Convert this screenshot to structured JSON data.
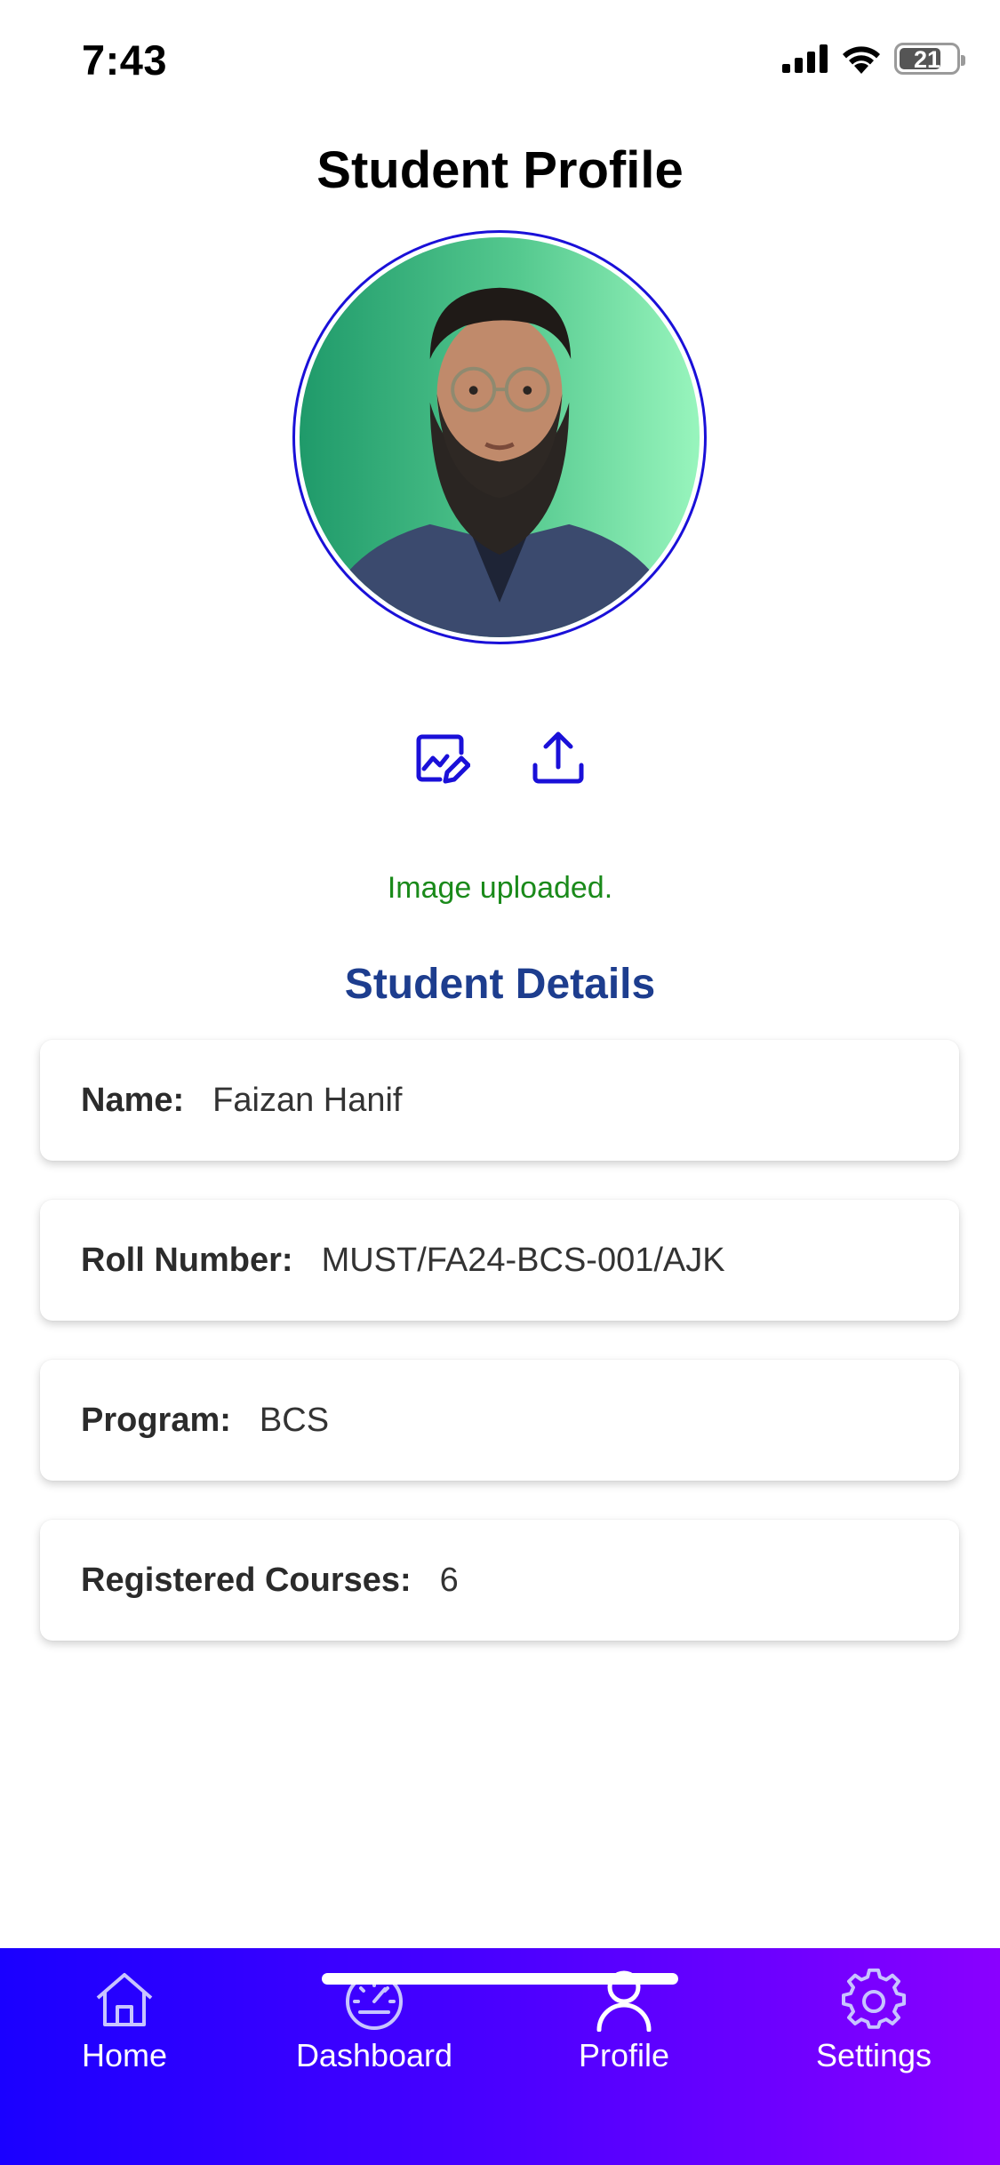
{
  "status_bar": {
    "time": "7:43",
    "battery": "21",
    "battery_level": 0.21
  },
  "page_title": "Student Profile",
  "actions": {
    "edit_icon": "image-edit-icon",
    "upload_icon": "upload-icon"
  },
  "upload_status": "Image uploaded.",
  "section_title": "Student Details",
  "details": [
    {
      "label": "Name:",
      "value": "Faizan Hanif"
    },
    {
      "label": "Roll Number:",
      "value": "MUST/FA24-BCS-001/AJK"
    },
    {
      "label": "Program:",
      "value": "BCS"
    },
    {
      "label": "Registered Courses:",
      "value": "6"
    }
  ],
  "tabs": [
    {
      "label": "Home",
      "icon": "home-icon"
    },
    {
      "label": "Dashboard",
      "icon": "speedometer-icon"
    },
    {
      "label": "Profile",
      "icon": "person-icon"
    },
    {
      "label": "Settings",
      "icon": "gear-icon"
    }
  ],
  "colors": {
    "accent": "#1a10d8",
    "success": "#1a8a1a",
    "section_title": "#1d3d8e",
    "tab_gradient_start": "#1a00ff",
    "tab_gradient_end": "#8a00ff"
  }
}
